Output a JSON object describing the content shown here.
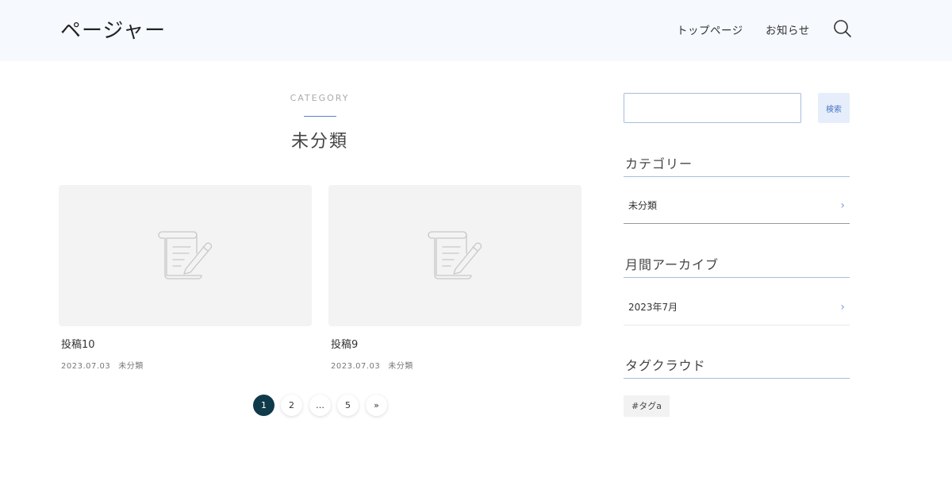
{
  "header": {
    "site_title": "ページャー",
    "nav": [
      {
        "label": "トップページ"
      },
      {
        "label": "お知らせ"
      }
    ]
  },
  "archive": {
    "label": "CATEGORY",
    "title": "未分類"
  },
  "posts": [
    {
      "title": "投稿10",
      "date": "2023.07.03",
      "category": "未分類"
    },
    {
      "title": "投稿9",
      "date": "2023.07.03",
      "category": "未分類"
    }
  ],
  "pagination": {
    "pages": [
      "1",
      "2",
      "…",
      "5",
      "»"
    ],
    "current": "1"
  },
  "sidebar": {
    "search": {
      "placeholder": "",
      "button_label": "検索"
    },
    "categories": {
      "title": "カテゴリー",
      "items": [
        {
          "label": "未分類"
        }
      ]
    },
    "archives": {
      "title": "月間アーカイブ",
      "items": [
        {
          "label": "2023年7月"
        }
      ]
    },
    "tags": {
      "title": "タグクラウド",
      "items": [
        {
          "label": "#タグa"
        }
      ]
    }
  },
  "colors": {
    "accent": "#5b84c9",
    "pager_active": "#0f3a4a",
    "header_bg": "#f6f9fd"
  },
  "icons": {
    "search": "search-icon",
    "thumbnail": "document-pen-icon",
    "chevron": "chevron-right-icon"
  }
}
